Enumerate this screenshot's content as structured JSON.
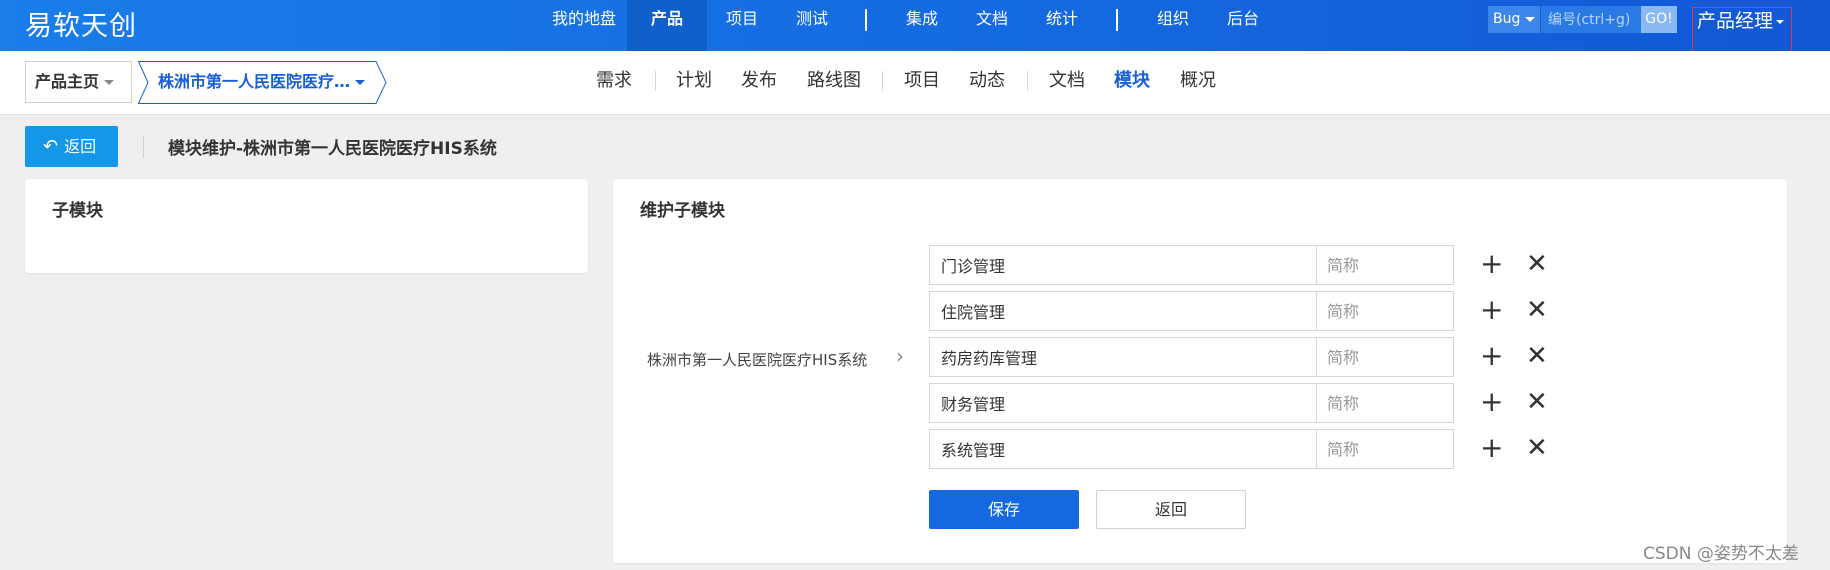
{
  "header": {
    "brand": "易软天创",
    "nav": [
      {
        "label": "我的地盘",
        "active": false
      },
      {
        "label": "产品",
        "active": true
      },
      {
        "label": "项目",
        "active": false
      },
      {
        "label": "测试",
        "active": false
      },
      {
        "label": "集成",
        "active": false
      },
      {
        "label": "文档",
        "active": false
      },
      {
        "label": "统计",
        "active": false
      },
      {
        "label": "组织",
        "active": false
      },
      {
        "label": "后台",
        "active": false
      }
    ],
    "search_type": "Bug",
    "search_placeholder": "编号(ctrl+g)",
    "go_label": "GO!",
    "user_menu": "产品经理"
  },
  "subnav": {
    "home_crumb": "产品主页",
    "product_crumb": "株洲市第一人民医院医疗…",
    "items": [
      {
        "label": "需求",
        "active": false
      },
      {
        "label": "计划",
        "active": false
      },
      {
        "label": "发布",
        "active": false
      },
      {
        "label": "路线图",
        "active": false
      },
      {
        "label": "项目",
        "active": false
      },
      {
        "label": "动态",
        "active": false
      },
      {
        "label": "文档",
        "active": false
      },
      {
        "label": "模块",
        "active": true
      },
      {
        "label": "概况",
        "active": false
      }
    ]
  },
  "actions": {
    "back_label": "返回",
    "page_title": "模块维护-株洲市第一人民医院医疗HIS系统"
  },
  "left_panel": {
    "title": "子模块"
  },
  "right_panel": {
    "title": "维护子模块",
    "parent_name": "株洲市第一人民医院医疗HIS系统",
    "short_placeholder": "简称",
    "modules": [
      {
        "name": "门诊管理",
        "short": ""
      },
      {
        "name": "住院管理",
        "short": ""
      },
      {
        "name": "药房药库管理",
        "short": ""
      },
      {
        "name": "财务管理",
        "short": ""
      },
      {
        "name": "系统管理",
        "short": ""
      }
    ],
    "save_label": "保存",
    "cancel_label": "返回"
  },
  "watermark": "CSDN @姿势不太差",
  "colors": {
    "topbar": "#1468e0",
    "accent": "#1a5fd6",
    "back_button": "#1497e8",
    "highlight_box": "#e63a3a"
  }
}
